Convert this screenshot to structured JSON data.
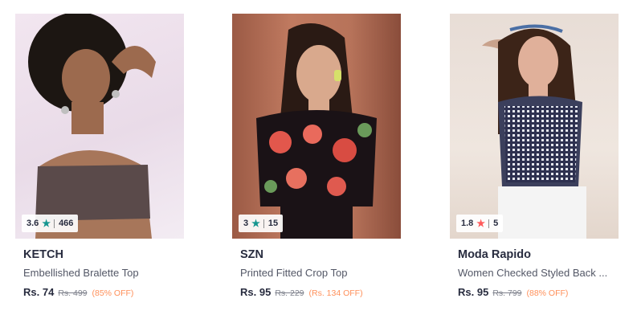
{
  "products": [
    {
      "brand": "KETCH",
      "name": "Embellished Bralette Top",
      "rating": "3.6",
      "rating_count": "466",
      "star_color": "#14958f",
      "price": "Rs. 74",
      "mrp": "Rs. 499",
      "discount": "(85% OFF)"
    },
    {
      "brand": "SZN",
      "name": "Printed Fitted Crop Top",
      "rating": "3",
      "rating_count": "15",
      "star_color": "#14958f",
      "price": "Rs. 95",
      "mrp": "Rs. 229",
      "discount": "(Rs. 134 OFF)"
    },
    {
      "brand": "Moda Rapido",
      "name": "Women Checked Styled Back ...",
      "rating": "1.8",
      "rating_count": "5",
      "star_color": "#ff5a5a",
      "price": "Rs. 95",
      "mrp": "Rs. 799",
      "discount": "(88% OFF)"
    }
  ],
  "icons": {
    "rating": "star-icon"
  },
  "colors": {
    "discount": "#ff905a",
    "brand_text": "#282c3f"
  }
}
